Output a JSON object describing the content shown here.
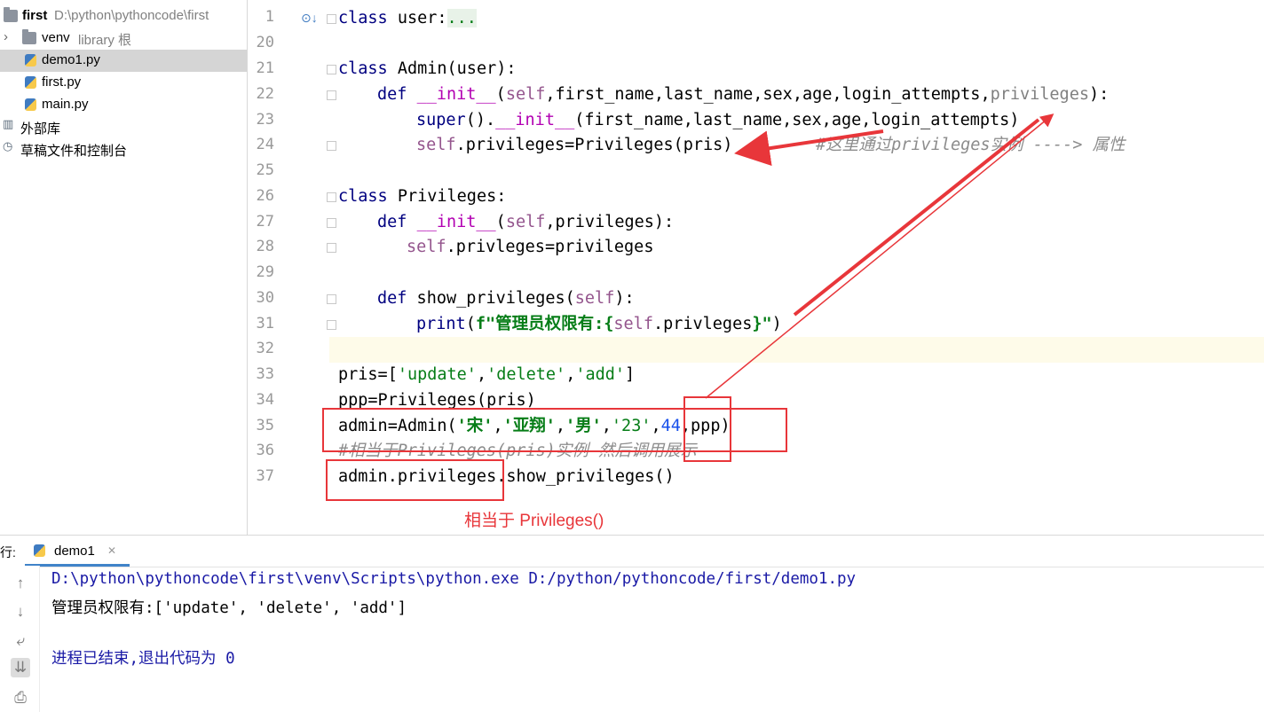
{
  "project": {
    "root": {
      "name": "first",
      "path": "D:\\python\\pythoncode\\first"
    },
    "items": [
      {
        "name": "venv",
        "suffix": "library 根"
      },
      {
        "name": "demo1.py"
      },
      {
        "name": "first.py"
      },
      {
        "name": "main.py"
      },
      {
        "name": "外部库"
      },
      {
        "name": "草稿文件和控制台"
      }
    ]
  },
  "editor": {
    "line_numbers": [
      "1",
      "20",
      "21",
      "22",
      "23",
      "24",
      "25",
      "26",
      "27",
      "28",
      "29",
      "30",
      "31",
      "32",
      "33",
      "34",
      "35",
      "36",
      "37"
    ],
    "code": {
      "l1_kw": "class",
      "l1_name": " user:",
      "l1_fold": "...",
      "l21_kw": "class",
      "l21_rest": " Admin(user):",
      "l22_def": "def",
      "l22_init": "__init__",
      "l22_a": "(",
      "l22_self": "self",
      "l22_b": ",first_name,last_name,sex,age,login_attempts,",
      "l22_priv": "privileges",
      "l22_c": "):",
      "l23_super": "super",
      "l23_a": "().",
      "l23_init": "__init__",
      "l23_b": "(first_name,last_name,sex,age,login_attempts)",
      "l24_self": "self",
      "l24_rest": ".privileges=Privileges(pris)",
      "l24_cmt": "#这里通过privileges实例 ----> 属性",
      "l26_kw": "class",
      "l26_rest": " Privileges:",
      "l27_def": "def",
      "l27_init": "__init__",
      "l27_a": "(",
      "l27_self": "self",
      "l27_b": ",privileges):",
      "l28_self": "self",
      "l28_rest": ".privleges=privileges",
      "l30_def": "def",
      "l30_a": " show_privileges(",
      "l30_self": "self",
      "l30_b": "):",
      "l31_print": "print",
      "l31_a": "(",
      "l31_f": "f\"管理员权限有:{",
      "l31_self": "self",
      "l31_b": ".privleges",
      "l31_c": "}\"",
      "l31_d": ")",
      "l33_a": "pris=[",
      "l33_s1": "'update'",
      "l33_c1": ",",
      "l33_s2": "'delete'",
      "l33_c2": ",",
      "l33_s3": "'add'",
      "l33_b": "]",
      "l34": "ppp=Privileges(pris)",
      "l35_a": "admin=Admin(",
      "l35_s1": "'宋'",
      "l35_c1": ",",
      "l35_s2": "'亚翔'",
      "l35_c2": ",",
      "l35_s3": "'男'",
      "l35_c3": ",",
      "l35_s4": "'23'",
      "l35_c4": ",",
      "l35_n": "44",
      "l35_b": ",ppp)",
      "l36_cmt": "#相当于Privileges(pris)实例 然后调用展示",
      "l37": "admin.privileges.show_privileges()"
    }
  },
  "annotation": {
    "label": "相当于 Privileges()",
    "color": "#e8363a"
  },
  "run": {
    "label": "行:",
    "tab": "demo1",
    "lines": [
      "D:\\python\\pythoncode\\first\\venv\\Scripts\\python.exe D:/python/pythoncode/first/demo1.py",
      "管理员权限有:['update', 'delete', 'add']",
      "进程已结束,退出代码为 0"
    ]
  },
  "icons": [
    "folder-icon",
    "python-file-icon",
    "library-icon",
    "scratch-icon",
    "up-arrow-icon",
    "down-arrow-icon",
    "wrap-icon",
    "scroll-end-icon",
    "print-icon",
    "close-icon"
  ]
}
